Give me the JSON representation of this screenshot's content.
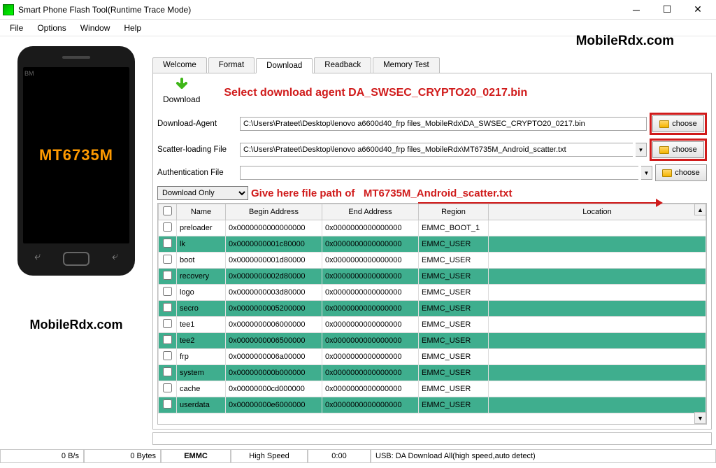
{
  "window": {
    "title": "Smart Phone Flash Tool(Runtime Trace Mode)"
  },
  "menu": [
    "File",
    "Options",
    "Window",
    "Help"
  ],
  "left": {
    "bm": "BM",
    "chip": "MT6735M",
    "watermark": "MobileRdx.com"
  },
  "watermark_top": "MobileRdx.com",
  "tabs": [
    "Welcome",
    "Format",
    "Download",
    "Readback",
    "Memory Test"
  ],
  "active_tab": "Download",
  "download_btn": "Download",
  "annotation1": "Select download agent DA_SWSEC_CRYPTO20_0217.bin",
  "annotation2_a": "Give here file path of",
  "annotation2_b": "MT6735M_Android_scatter.txt",
  "fields": {
    "da_label": "Download-Agent",
    "da_value": "C:\\Users\\Prateet\\Desktop\\lenovo a6600d40_frp files_MobileRdx\\DA_SWSEC_CRYPTO20_0217.bin",
    "scatter_label": "Scatter-loading File",
    "scatter_value": "C:\\Users\\Prateet\\Desktop\\lenovo a6600d40_frp files_MobileRdx\\MT6735M_Android_scatter.txt",
    "auth_label": "Authentication File",
    "auth_value": "",
    "choose": "choose"
  },
  "mode": "Download Only",
  "grid": {
    "headers": [
      "",
      "Name",
      "Begin Address",
      "End Address",
      "Region",
      "Location"
    ],
    "rows": [
      {
        "name": "preloader",
        "begin": "0x0000000000000000",
        "end": "0x0000000000000000",
        "region": "EMMC_BOOT_1",
        "g": false
      },
      {
        "name": "lk",
        "begin": "0x0000000001c80000",
        "end": "0x0000000000000000",
        "region": "EMMC_USER",
        "g": true
      },
      {
        "name": "boot",
        "begin": "0x0000000001d80000",
        "end": "0x0000000000000000",
        "region": "EMMC_USER",
        "g": false
      },
      {
        "name": "recovery",
        "begin": "0x0000000002d80000",
        "end": "0x0000000000000000",
        "region": "EMMC_USER",
        "g": true
      },
      {
        "name": "logo",
        "begin": "0x0000000003d80000",
        "end": "0x0000000000000000",
        "region": "EMMC_USER",
        "g": false
      },
      {
        "name": "secro",
        "begin": "0x0000000005200000",
        "end": "0x0000000000000000",
        "region": "EMMC_USER",
        "g": true
      },
      {
        "name": "tee1",
        "begin": "0x0000000006000000",
        "end": "0x0000000000000000",
        "region": "EMMC_USER",
        "g": false
      },
      {
        "name": "tee2",
        "begin": "0x0000000006500000",
        "end": "0x0000000000000000",
        "region": "EMMC_USER",
        "g": true
      },
      {
        "name": "frp",
        "begin": "0x0000000006a00000",
        "end": "0x0000000000000000",
        "region": "EMMC_USER",
        "g": false
      },
      {
        "name": "system",
        "begin": "0x000000000b000000",
        "end": "0x0000000000000000",
        "region": "EMMC_USER",
        "g": true
      },
      {
        "name": "cache",
        "begin": "0x00000000cd000000",
        "end": "0x0000000000000000",
        "region": "EMMC_USER",
        "g": false
      },
      {
        "name": "userdata",
        "begin": "0x00000000e6000000",
        "end": "0x0000000000000000",
        "region": "EMMC_USER",
        "g": true
      }
    ]
  },
  "status": {
    "speed": "0 B/s",
    "bytes": "0 Bytes",
    "storage": "EMMC",
    "mode": "High Speed",
    "time": "0:00",
    "usb": "USB: DA Download All(high speed,auto detect)"
  }
}
